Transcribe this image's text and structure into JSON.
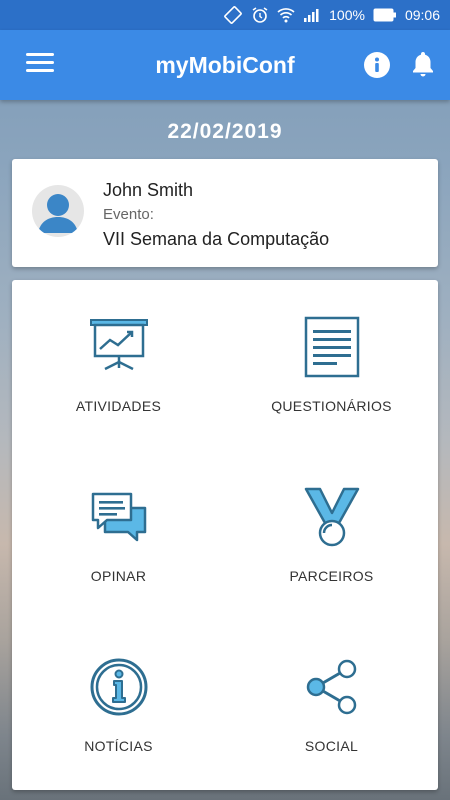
{
  "status_bar": {
    "battery": "100%",
    "time": "09:06"
  },
  "app_bar": {
    "title": "myMobiConf"
  },
  "date": "22/02/2019",
  "profile": {
    "name": "John Smith",
    "event_label": "Evento:",
    "event_name": "VII Semana da Computação"
  },
  "menu": {
    "items": [
      {
        "label": "ATIVIDADES",
        "icon": "presentation-chart-icon"
      },
      {
        "label": "QUESTIONÁRIOS",
        "icon": "document-icon"
      },
      {
        "label": "OPINAR",
        "icon": "chat-bubbles-icon"
      },
      {
        "label": "PARCEIROS",
        "icon": "medal-icon"
      },
      {
        "label": "NOTÍCIAS",
        "icon": "info-circle-icon"
      },
      {
        "label": "SOCIAL",
        "icon": "share-icon"
      }
    ]
  },
  "colors": {
    "app_bar": "#3b8ae6",
    "status_bar": "#2c70c8",
    "icon_stroke": "#2e6e91",
    "icon_fill": "#5bb8e6"
  }
}
